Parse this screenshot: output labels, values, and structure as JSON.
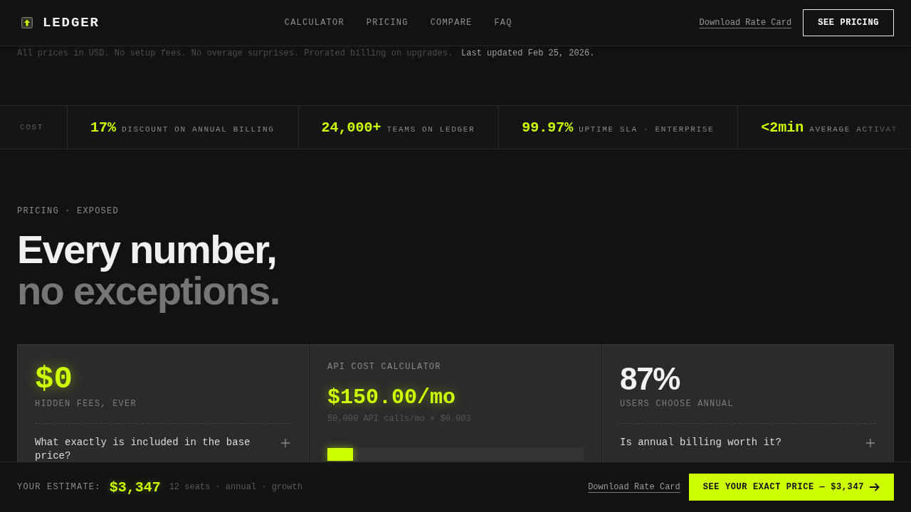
{
  "header": {
    "brand": "LEDGER",
    "nav": [
      "CALCULATOR",
      "PRICING",
      "COMPARE",
      "FAQ"
    ],
    "link": "Download Rate Card",
    "button": "SEE PRICING"
  },
  "notice": {
    "text": "All prices in USD. No setup fees. No overage surprises. Prorated billing on upgrades.",
    "updated": "Last updated Feb 25, 2026."
  },
  "ticker": [
    {
      "label": "COST"
    },
    {
      "value": "17%",
      "label": "DISCOUNT ON ANNUAL BILLING"
    },
    {
      "value": "24,000+",
      "label": "TEAMS ON LEDGER"
    },
    {
      "value": "99.97%",
      "label": "UPTIME SLA · ENTERPRISE"
    },
    {
      "value": "<2min",
      "label": "AVERAGE ACTIVAT"
    }
  ],
  "hero": {
    "eyebrow": "PRICING · EXPOSED",
    "title": "Every number,",
    "title_muted": "no exceptions."
  },
  "cards": [
    {
      "kind": "stat",
      "accent": true,
      "value": "$0",
      "label": "HIDDEN FEES, EVER",
      "faq": {
        "question": "What exactly is included in the base price?",
        "expanded": false
      }
    },
    {
      "kind": "calculator",
      "label": "API COST CALCULATOR",
      "price": "$150.00/mo",
      "formula": "50,000 API calls/mo × $0.003",
      "slider": {
        "level": 0.1
      }
    },
    {
      "kind": "stat",
      "accent": false,
      "value": "87%",
      "label": "USERS CHOOSE ANNUAL",
      "faq": {
        "question": "Is annual billing worth it?",
        "expanded": false
      }
    }
  ],
  "estimate_bar": {
    "label": "YOUR ESTIMATE:",
    "amount": "$3,347",
    "details": "12 seats · annual · growth",
    "link": "Download Rate Card",
    "button": "SEE YOUR EXACT PRICE — $3,347"
  }
}
